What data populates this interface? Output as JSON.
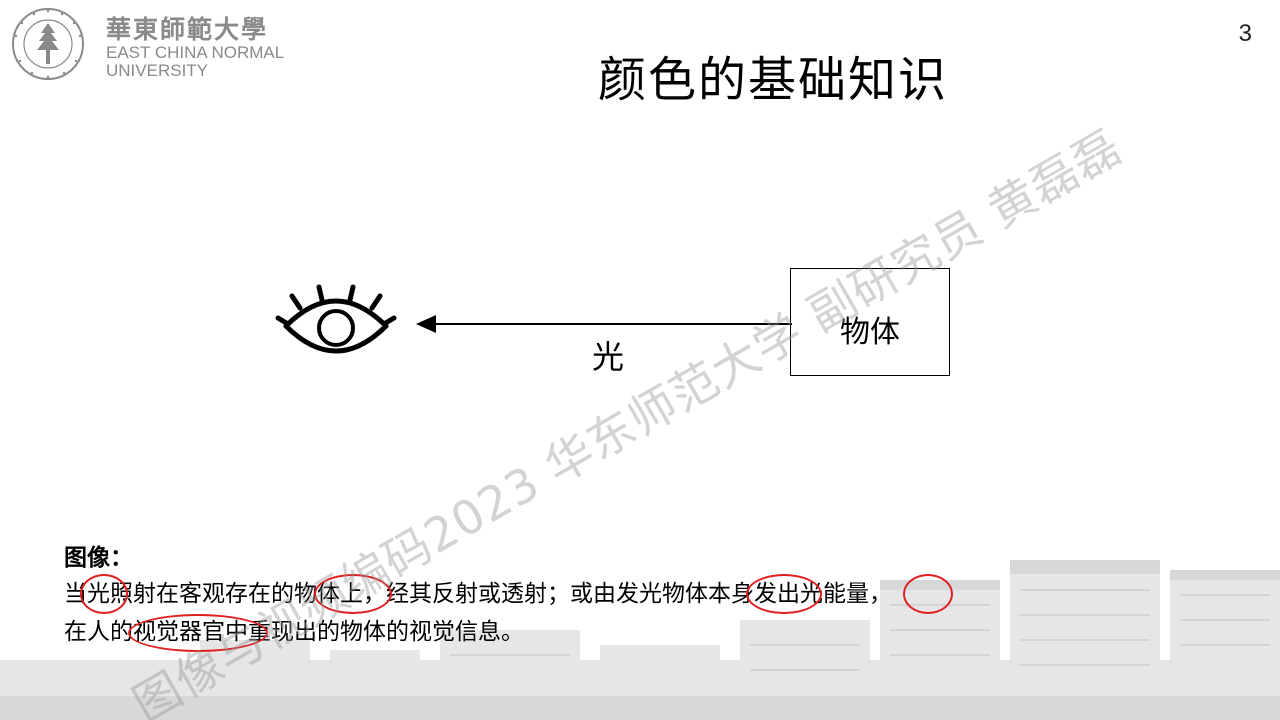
{
  "header": {
    "logo_cn": "華東師範大學",
    "logo_en_line1": "EAST CHINA NORMAL",
    "logo_en_line2": "UNIVERSITY",
    "page_number": "3",
    "title": "颜色的基础知识"
  },
  "diagram": {
    "object_label": "物体",
    "light_label": "光"
  },
  "content": {
    "heading": "图像：",
    "line1": "当光照射在客观存在的物体上，经其反射或透射；或由发光物体本身发出光能量，",
    "line2": "在人的视觉器官中重现出的物体的视觉信息。"
  },
  "watermark": "图像与视频编码2023 华东师范大学 副研究员 黄磊磊",
  "colors": {
    "highlight": "#e02020",
    "logo_gray": "#8a8a8a"
  }
}
